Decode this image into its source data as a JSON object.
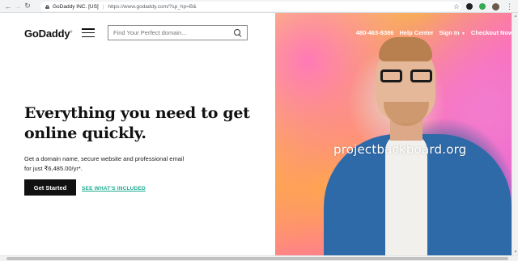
{
  "browser": {
    "site_org": "GoDaddy INC. [US]",
    "url": "https://www.godaddy.com/?sp_hp=B&"
  },
  "header": {
    "logo": "GoDaddy",
    "search_placeholder": "Find Your Perfect domain...",
    "phone": "480-463-8386",
    "help": "Help Center",
    "sign_in": "Sign In",
    "checkout": "Checkout Now"
  },
  "hero": {
    "headline": "Everything you need to get online quickly.",
    "subtext": "Get a domain name, secure website and professional email for just ₹6,485.00/yr*.",
    "cta": "Get Started",
    "secondary_link": "SEE WHAT'S INCLUDED",
    "watermark": "projectbackboard.org"
  },
  "colors": {
    "link_green": "#1bab8f",
    "cta_bg": "#111111"
  }
}
